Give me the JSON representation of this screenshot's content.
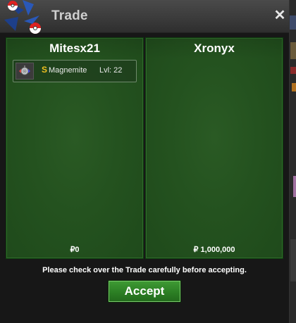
{
  "window": {
    "title": "Trade",
    "close_label": "✕"
  },
  "left_panel": {
    "player_name": "Mitesx21",
    "items": [
      {
        "shiny_mark": "S",
        "pokemon_name": "Magnemite",
        "level_text": "Lvl: 22",
        "sprite": "magnemite-sprite"
      }
    ],
    "money": "₽0"
  },
  "right_panel": {
    "player_name": "Xronyx",
    "items": [],
    "money": "₽ 1,000,000"
  },
  "notice": "Please check over the Trade carefully before accepting.",
  "accept_label": "Accept",
  "colors": {
    "panel_green": "#24521f",
    "accept_green": "#2c7f24",
    "shiny_gold": "#f0c020",
    "title_gray": "#cfcfcf"
  }
}
